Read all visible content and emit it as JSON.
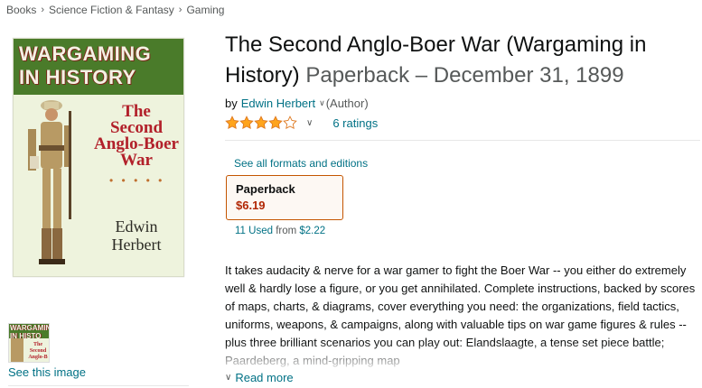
{
  "breadcrumb": {
    "items": [
      "Books",
      "Science Fiction & Fantasy",
      "Gaming"
    ],
    "separator": "›"
  },
  "cover": {
    "band_line1": "WARGAMING",
    "band_line2": "IN HISTORY",
    "title_line1": "The",
    "title_line2": "Second",
    "title_line3": "Anglo-Boer",
    "title_line4": "War",
    "dots": "• • • • •",
    "author_line1": "Edwin",
    "author_line2": "Herbert"
  },
  "thumbnail": {
    "band_line1": "WARGAMIN",
    "band_line2": "IN HISTO",
    "title": "The Second Anglo-B"
  },
  "see_image_label": "See this image",
  "product": {
    "title": "The Second Anglo-Boer War (Wargaming in History)",
    "format_date": "Paperback – December 31, 1899",
    "by_label": "by",
    "author": "Edwin Herbert",
    "role": "(Author)",
    "rating_value": 4.0,
    "ratings_count": "6 ratings",
    "star_color": "#ffa41c"
  },
  "formats": {
    "see_all_label": "See all formats and editions",
    "selected_name": "Paperback",
    "selected_price": "$6.19",
    "used_count": "11 Used",
    "used_from_label": "from",
    "used_from_price": "$2.22"
  },
  "description": {
    "text": "It takes audacity & nerve for a war gamer to fight the Boer War -- you either do extremely well & hardly lose a figure, or you get annihilated. Complete instructions, backed by scores of maps, charts, & diagrams, cover everything you need: the organizations, field tactics, uniforms, weapons, & campaigns, along with valuable tips on war game figures & rules -- plus three brilliant scenarios you can play out: Elandslaagte, a tense set piece battle; Paardeberg, a mind-gripping map",
    "read_more": "Read more"
  },
  "colors": {
    "link": "#007185",
    "price": "#b12704",
    "selected_border": "#c45500",
    "cover_band": "#4a7b2a",
    "cover_title": "#b2202a"
  }
}
